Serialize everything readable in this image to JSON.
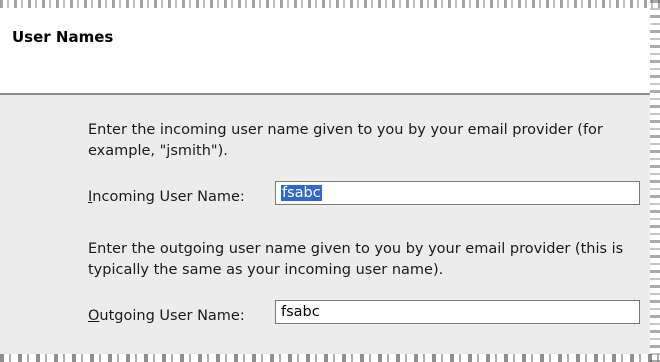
{
  "header": {
    "title": "User Names"
  },
  "incoming": {
    "description": "Enter the incoming user name given to you by your email provider (for example, \"jsmith\").",
    "label_mnemonic": "I",
    "label_rest": "ncoming User Name:",
    "value": "fsabc"
  },
  "outgoing": {
    "description": "Enter the outgoing user name given to you by your email provider (this is typically the same as your incoming user name).",
    "label_mnemonic": "O",
    "label_rest": "utgoing User Name:",
    "value": "fsabc"
  },
  "colors": {
    "panel_bg": "#ececec",
    "selection": "#316ac5"
  }
}
